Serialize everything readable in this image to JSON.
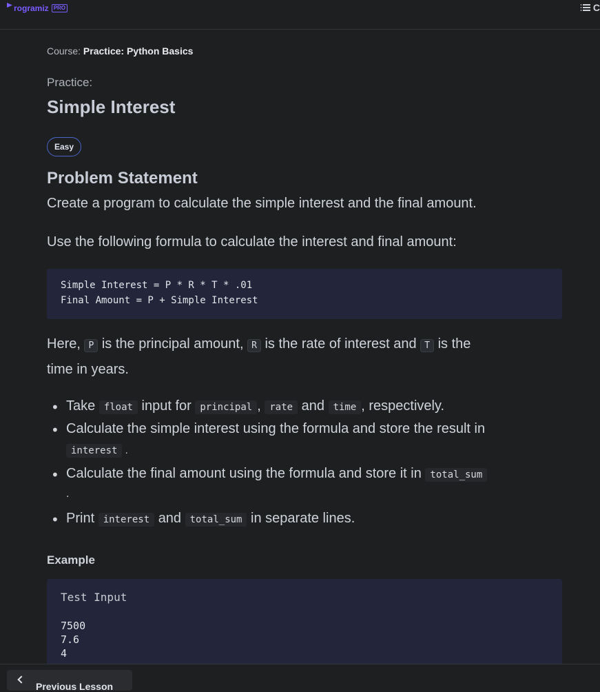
{
  "header": {
    "logo_text": "rogramiz",
    "pro_badge": "PRO",
    "menu_label": "C"
  },
  "breadcrumb": {
    "prefix": "Course:",
    "course_name": "Practice: Python Basics"
  },
  "practice": {
    "label": "Practice:",
    "title": "Simple Interest",
    "difficulty": "Easy"
  },
  "problem": {
    "heading": "Problem Statement",
    "intro": "Create a program to calculate the simple interest and the final amount.",
    "formula_intro": "Use the following formula to calculate the interest and final amount:",
    "formula_lines": [
      "Simple Interest = P * R * T * .01",
      "Final Amount = P + Simple Interest"
    ],
    "here_parts": {
      "t1": "Here,",
      "c1": "P",
      "t2": "is the principal amount,",
      "c2": "R",
      "t3": "is the rate of interest and",
      "c3": "T",
      "t4": "is the",
      "t5": "time in years."
    },
    "bullets": {
      "b1": {
        "t1": "Take",
        "c1": "float",
        "t2": "input for",
        "c2": "principal",
        "t3": ",",
        "c3": "rate",
        "t4": "and",
        "c4": "time",
        "t5": ", respectively."
      },
      "b2": {
        "t1": "Calculate the simple interest using the formula and store the result in",
        "c1": "interest",
        "t2": "."
      },
      "b3": {
        "t1": "Calculate the final amount using the formula and store it in",
        "c1": "total_sum",
        "t2": "."
      },
      "b4": {
        "t1": "Print",
        "c1": "interest",
        "t2": "and",
        "c2": "total_sum",
        "t3": "in separate lines."
      }
    }
  },
  "example": {
    "heading": "Example",
    "input_label": "Test Input",
    "input_lines": [
      "7500",
      "7.6",
      "4"
    ]
  },
  "footer": {
    "prev_label": "Previous Lesson"
  }
}
